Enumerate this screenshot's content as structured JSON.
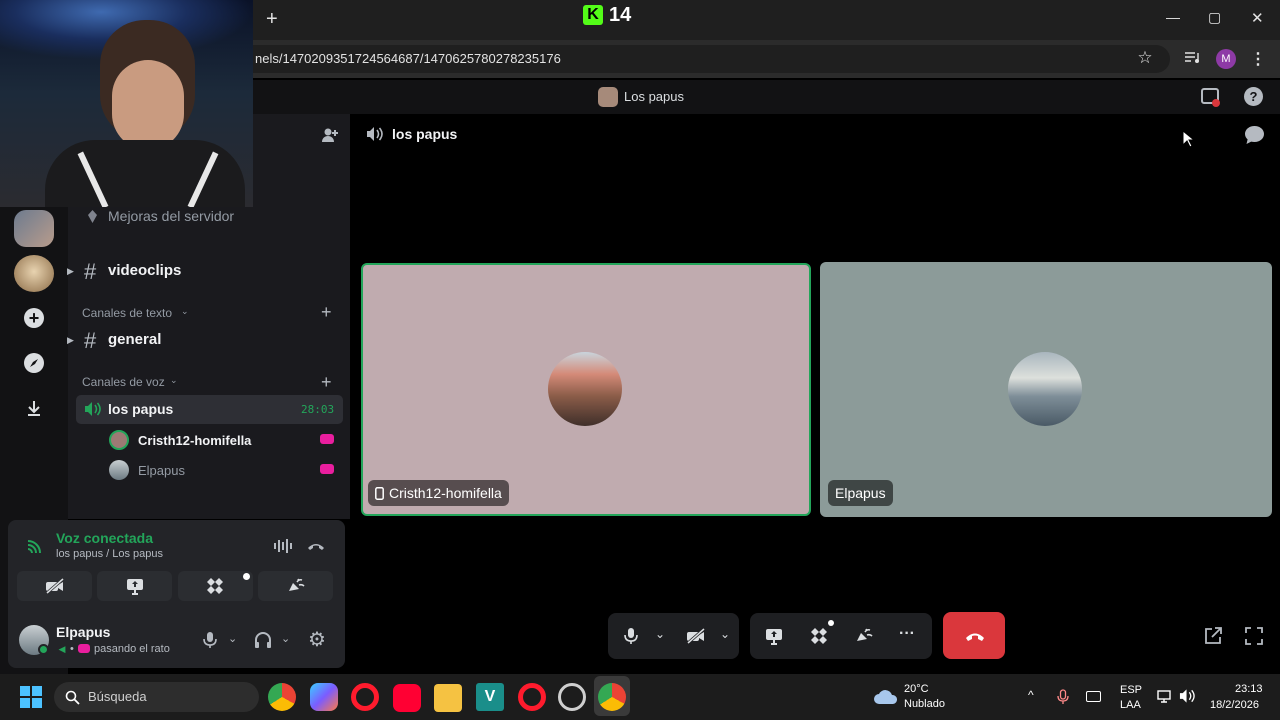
{
  "browser": {
    "new_tab": "+",
    "tab_logo": "K",
    "tab_count": "14",
    "url": "nels/1470209351724564687/1470625780278235176",
    "profile_initial": "M",
    "window_controls": [
      "—",
      "▢",
      "✕"
    ]
  },
  "discord_top": {
    "server_name": "Los papus",
    "help": "?"
  },
  "channel_header": {
    "name": "los papus"
  },
  "channels": {
    "boost_label": "Mejoras del servidor",
    "videoclips": "videoclips",
    "text_category": "Canales de texto",
    "general": "general",
    "voice_category": "Canales de voz",
    "voice_channel": "los papus",
    "voice_timer": "28:03",
    "members": [
      {
        "name": "Cristh12-homifella"
      },
      {
        "name": "Elpapus"
      }
    ],
    "hash": "#",
    "plus": "+"
  },
  "voice_panel": {
    "status": "Voz conectada",
    "location": "los papus / Los papus"
  },
  "user": {
    "name": "Elpapus",
    "status": "pasando el rato"
  },
  "tiles": [
    {
      "name": "Cristh12-homifella",
      "bg": "#c0abaf",
      "speaking": true
    },
    {
      "name": "Elpapus",
      "bg": "#8c9b99",
      "speaking": false
    }
  ],
  "controls": {
    "more": "···"
  },
  "taskbar": {
    "search_placeholder": "Búsqueda",
    "weather_temp": "20°C",
    "weather_desc": "Nublado",
    "lang_top": "ESP",
    "lang_bottom": "LAA",
    "time": "23:13",
    "date": "18/2/2026"
  },
  "colors": {
    "accent_green": "#23a55a",
    "hangup_red": "#da373c",
    "blurple": "#5865f2"
  }
}
